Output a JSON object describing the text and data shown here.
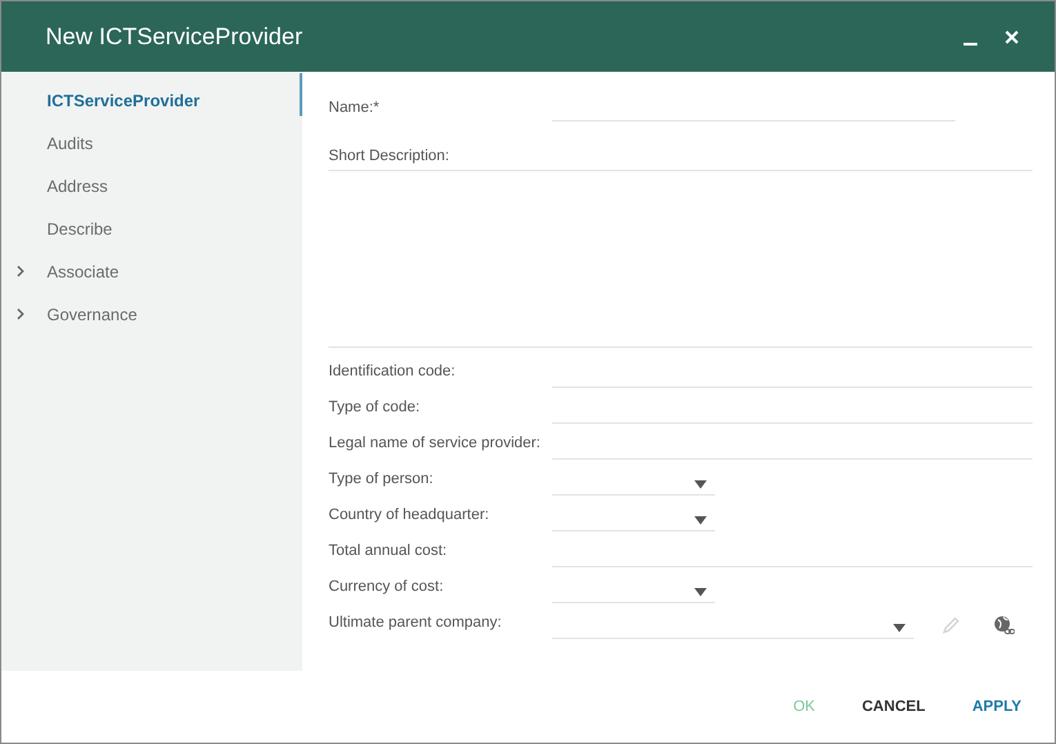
{
  "window": {
    "title": "New ICTServiceProvider"
  },
  "sidebar": {
    "items": [
      {
        "label": "ICTServiceProvider",
        "selected": true,
        "expandable": false
      },
      {
        "label": "Audits",
        "selected": false,
        "expandable": false
      },
      {
        "label": "Address",
        "selected": false,
        "expandable": false
      },
      {
        "label": "Describe",
        "selected": false,
        "expandable": false
      },
      {
        "label": "Associate",
        "selected": false,
        "expandable": true
      },
      {
        "label": "Governance",
        "selected": false,
        "expandable": true
      }
    ]
  },
  "form": {
    "name": {
      "label": "Name:*"
    },
    "short_description": {
      "label": "Short Description:"
    },
    "fields": [
      {
        "label": "Identification code:",
        "kind": "text"
      },
      {
        "label": "Type of code:",
        "kind": "text"
      },
      {
        "label": "Legal name of service provider:",
        "kind": "text"
      },
      {
        "label": "Type of person:",
        "kind": "select"
      },
      {
        "label": "Country of headquarter:",
        "kind": "select"
      },
      {
        "label": "Total annual cost:",
        "kind": "text"
      },
      {
        "label": "Currency of cost:",
        "kind": "select"
      },
      {
        "label": "Ultimate parent company:",
        "kind": "lookup"
      }
    ]
  },
  "buttons": [
    {
      "label": "OK",
      "kind": "confirm",
      "disabled": true
    },
    {
      "label": "CANCEL",
      "kind": "dismiss",
      "disabled": false
    },
    {
      "label": "APPLY",
      "kind": "apply",
      "disabled": false
    }
  ]
}
